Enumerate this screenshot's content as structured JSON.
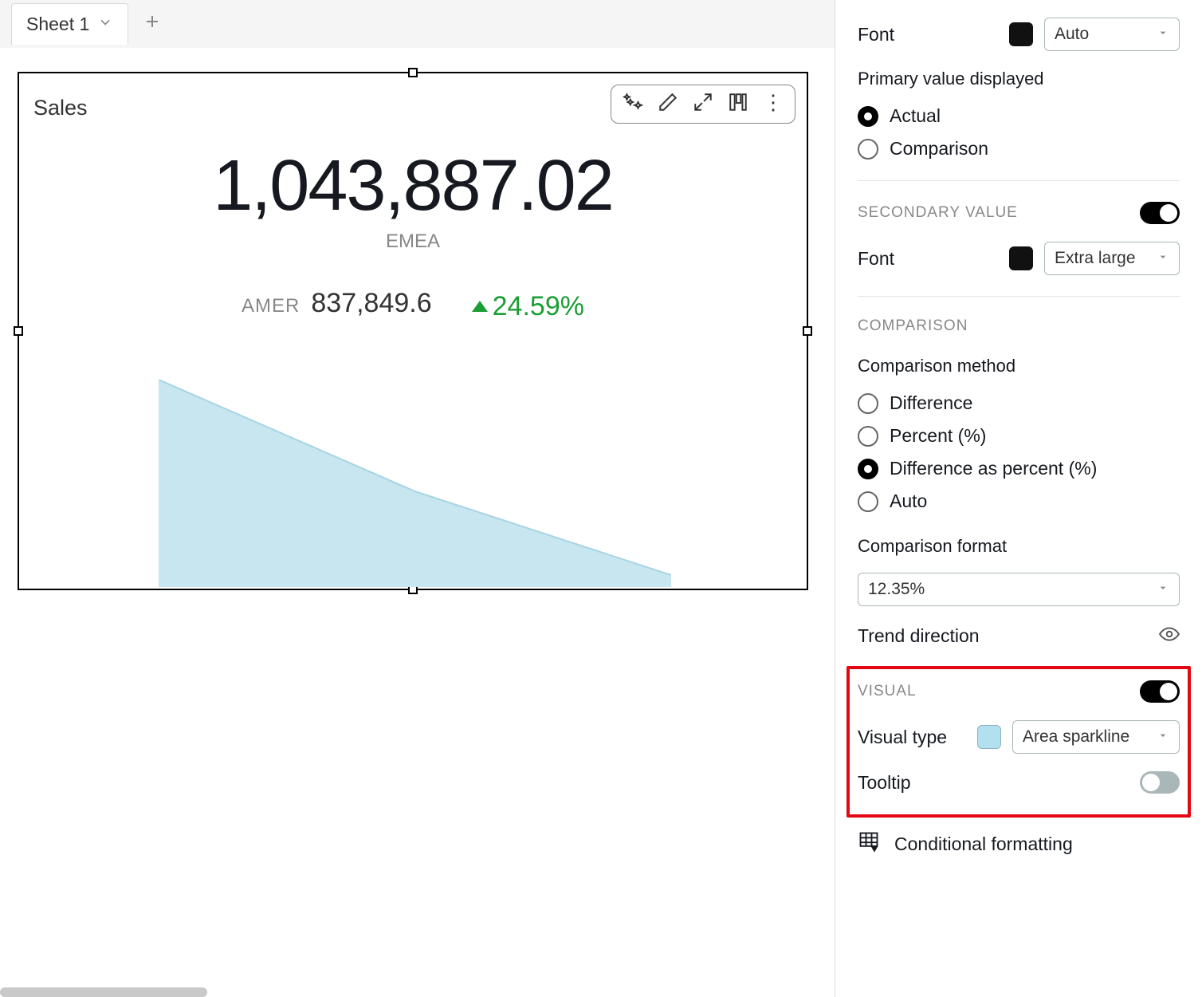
{
  "tabs": {
    "active": "Sheet 1"
  },
  "card": {
    "title": "Sales",
    "primary_value": "1,043,887.02",
    "primary_sub": "EMEA",
    "comp_label": "AMER",
    "comp_value": "837,849.6",
    "pct": "24.59%"
  },
  "chart_data": {
    "type": "area",
    "x": [
      0,
      1,
      2
    ],
    "values": [
      100,
      55,
      8
    ],
    "color": "#c7e6f0",
    "stroke": "#a8d4e2"
  },
  "panel": {
    "font_label": "Font",
    "font_select": "Auto",
    "primary_label": "Primary value displayed",
    "primary_options": {
      "actual": "Actual",
      "comparison": "Comparison"
    },
    "secondary_title": "SECONDARY VALUE",
    "secondary_font_label": "Font",
    "secondary_font_select": "Extra large",
    "comparison_title": "COMPARISON",
    "comparison_method_label": "Comparison method",
    "comparison_options": {
      "difference": "Difference",
      "percent": "Percent (%)",
      "diff_percent": "Difference as percent (%)",
      "auto": "Auto"
    },
    "comparison_format_label": "Comparison format",
    "comparison_format_value": "12.35%",
    "trend_label": "Trend direction",
    "visual_title": "VISUAL",
    "visual_type_label": "Visual type",
    "visual_type_value": "Area sparkline",
    "tooltip_label": "Tooltip",
    "cond_label": "Conditional formatting"
  }
}
